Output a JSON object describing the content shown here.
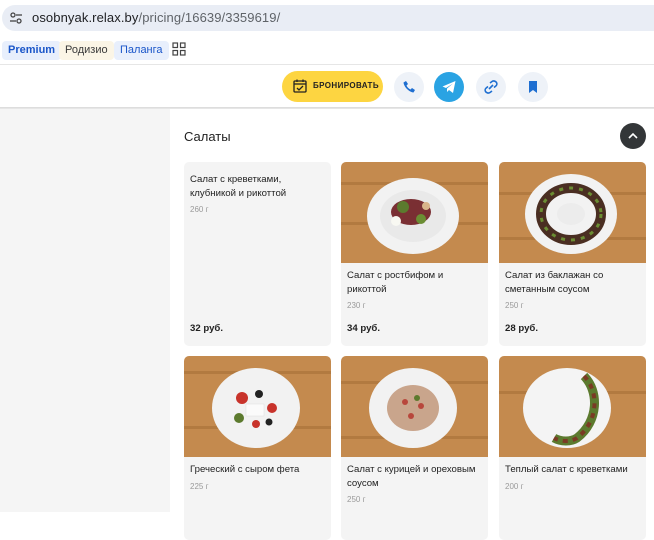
{
  "browser": {
    "url_host": "osobnyak.relax.by",
    "url_path": "/pricing/16639/3359619/",
    "bookmarks": [
      "Premium",
      "Родизио",
      "Паланга"
    ]
  },
  "actions": {
    "book_label": "БРОНИРОВАТЬ",
    "icons": [
      "phone-icon",
      "telegram-icon",
      "link-icon",
      "bookmark-icon"
    ]
  },
  "section": {
    "title": "Салаты",
    "items": [
      {
        "name": "Салат с креветками, клубникой и рикоттой",
        "weight": "260 г",
        "price": "32 руб.",
        "has_photo": false
      },
      {
        "name": "Салат с ростбифом и рикоттой",
        "weight": "230 г",
        "price": "34 руб.",
        "has_photo": true
      },
      {
        "name": "Салат из баклажан со сметанным соусом",
        "weight": "250 г",
        "price": "28 руб.",
        "has_photo": true
      },
      {
        "name": "Греческий с сыром фета",
        "weight": "225 г",
        "price": "",
        "has_photo": true
      },
      {
        "name": "Салат с курицей и ореховым соусом",
        "weight": "250 г",
        "price": "",
        "has_photo": true
      },
      {
        "name": "Теплый салат с креветками",
        "weight": "200 г",
        "price": "",
        "has_photo": true
      }
    ]
  },
  "colors": {
    "accent_yellow": "#fdd541",
    "telegram_blue": "#2aa3e3",
    "wood": "#c48a4e"
  }
}
